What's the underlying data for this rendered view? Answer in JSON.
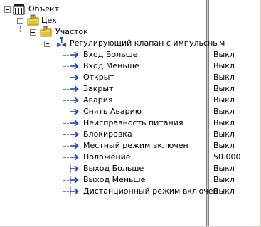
{
  "tree": {
    "root": {
      "label": "Объект",
      "icon": "building-icon",
      "expanded": true
    },
    "workshop": {
      "label": "Цех",
      "icon": "folder-icon",
      "expanded": true
    },
    "site": {
      "label": "Участок",
      "icon": "folder-icon",
      "expanded": true
    },
    "valve": {
      "label": "Регулирующий клапан с импульсным",
      "icon": "valve-icon",
      "expanded": true
    },
    "signals": [
      {
        "label": "Вход Больше",
        "value": "Выкл",
        "icon": "input-arrow-icon"
      },
      {
        "label": "Вход Меньше",
        "value": "Выкл",
        "icon": "input-arrow-icon"
      },
      {
        "label": "Открыт",
        "value": "Выкл",
        "icon": "input-arrow-icon"
      },
      {
        "label": "Закрыт",
        "value": "Выкл",
        "icon": "input-arrow-icon"
      },
      {
        "label": "Авария",
        "value": "Выкл",
        "icon": "input-arrow-icon"
      },
      {
        "label": "Снять Аварию",
        "value": "Выкл",
        "icon": "input-arrow-icon"
      },
      {
        "label": "Неисправность питания",
        "value": "Выкл",
        "icon": "input-arrow-icon"
      },
      {
        "label": "Блокировка",
        "value": "Выкл",
        "icon": "input-arrow-icon"
      },
      {
        "label": "Местный режим включен",
        "value": "Выкл",
        "icon": "input-arrow-icon"
      },
      {
        "label": "Положение",
        "value": "50.000",
        "icon": "input-arrow-icon"
      },
      {
        "label": "Выход Больше",
        "value": "Выкл",
        "icon": "output-arrow-icon"
      },
      {
        "label": "Выход Меньше",
        "value": "Выкл",
        "icon": "output-arrow-icon"
      },
      {
        "label": "Дистанционный режим включен",
        "value": "Выкл",
        "icon": "output-arrow-icon"
      }
    ]
  },
  "colors": {
    "arrow": "#1f3fd0",
    "folder": "#f5d442",
    "background": "#ffffff",
    "splitter": "#d4d0c8"
  }
}
